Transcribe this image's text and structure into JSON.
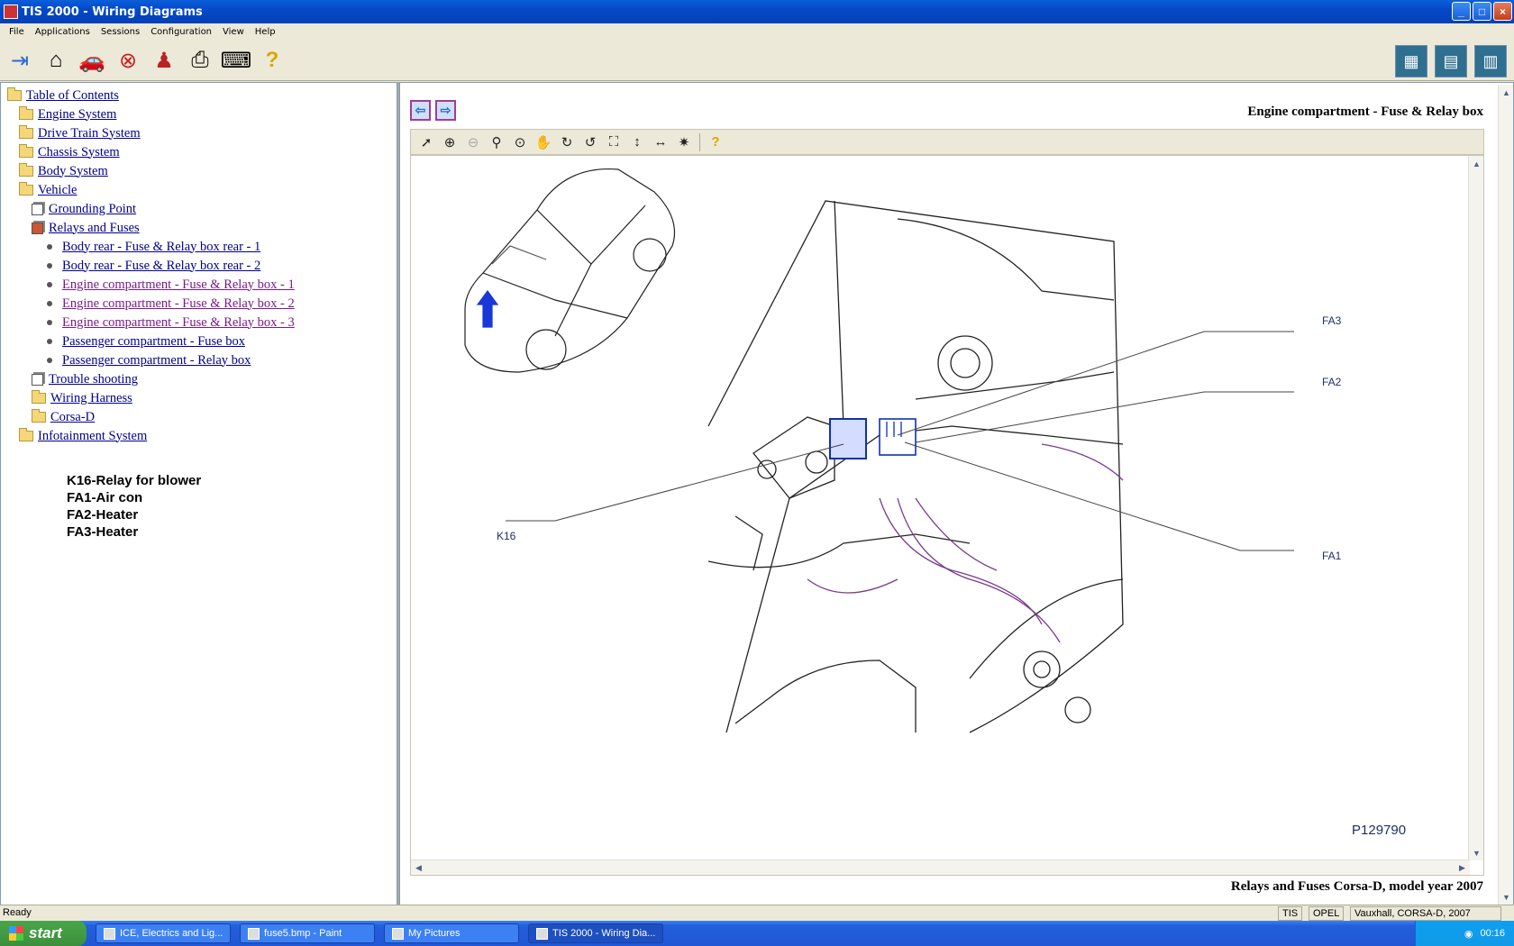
{
  "window": {
    "title": "TIS 2000 - Wiring Diagrams"
  },
  "menu": [
    "File",
    "Applications",
    "Sessions",
    "Configuration",
    "View",
    "Help"
  ],
  "tree": {
    "root": "Table of Contents",
    "items": [
      "Engine System",
      "Drive Train System",
      "Chassis System",
      "Body System",
      "Vehicle",
      "Grounding Point",
      "Relays and Fuses",
      "Body rear - Fuse & Relay box rear - 1",
      "Body rear - Fuse & Relay box rear - 2",
      "Engine compartment - Fuse & Relay box - 1",
      "Engine compartment - Fuse & Relay box - 2",
      "Engine compartment - Fuse & Relay box - 3",
      "Passenger compartment - Fuse box",
      "Passenger compartment - Relay box",
      "Trouble shooting",
      "Wiring Harness",
      "Corsa-D",
      "Infotainment System"
    ]
  },
  "notes": [
    "K16-Relay for blower",
    "FA1-Air con",
    "FA2-Heater",
    "FA3-Heater"
  ],
  "document": {
    "title": "Engine compartment - Fuse & Relay box",
    "footer": "Relays and Fuses Corsa-D, model year 2007"
  },
  "diagram": {
    "labels": {
      "fa3": "FA3",
      "fa2": "FA2",
      "fa1": "FA1",
      "k16": "K16"
    },
    "part_number": "P129790"
  },
  "status": {
    "ready": "Ready",
    "f1": "TIS",
    "f2": "OPEL",
    "f3": "Vauxhall, CORSA-D, 2007"
  },
  "taskbar": {
    "start": "start",
    "tasks": [
      "ICE, Electrics and Lig...",
      "fuse5.bmp - Paint",
      "My Pictures",
      "TIS 2000 - Wiring Dia..."
    ],
    "clock": "00:16"
  }
}
